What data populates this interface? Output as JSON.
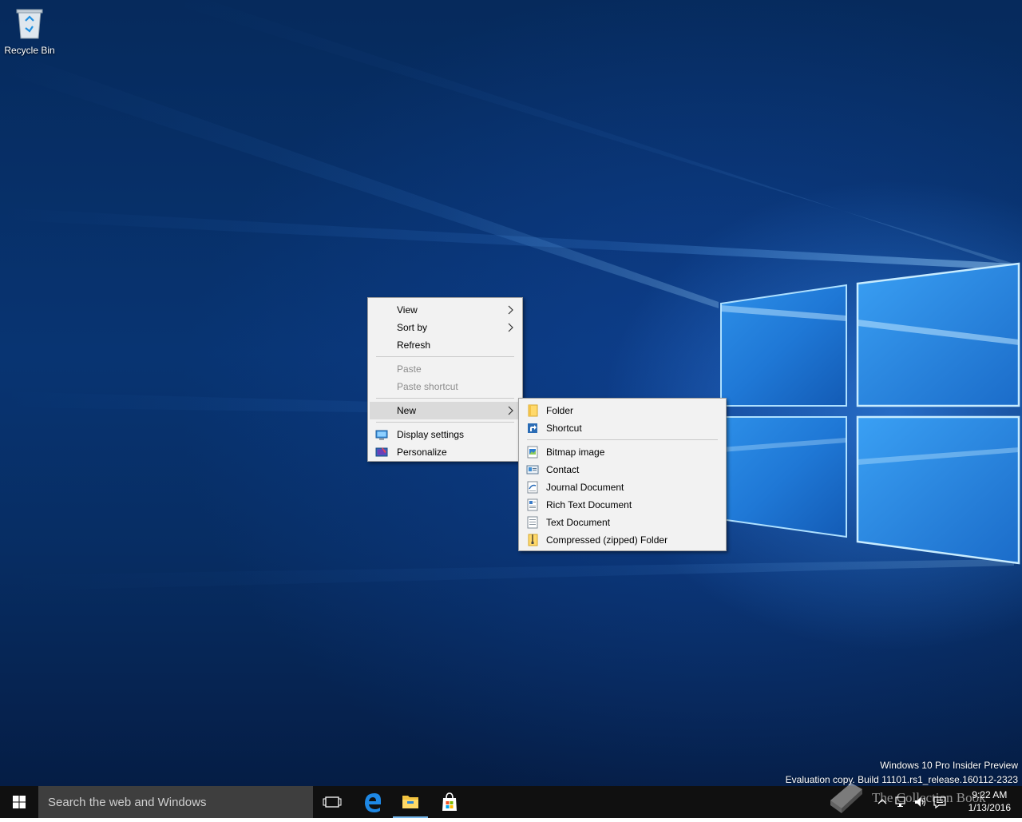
{
  "desktop": {
    "icons": [
      {
        "label": "Recycle Bin",
        "icon": "recycle-bin-icon"
      }
    ]
  },
  "context_menu": {
    "items": [
      {
        "label": "View",
        "has_submenu": true,
        "enabled": true
      },
      {
        "label": "Sort by",
        "has_submenu": true,
        "enabled": true
      },
      {
        "label": "Refresh",
        "has_submenu": false,
        "enabled": true
      },
      {
        "label": "Paste",
        "has_submenu": false,
        "enabled": false
      },
      {
        "label": "Paste shortcut",
        "has_submenu": false,
        "enabled": false
      },
      {
        "label": "New",
        "has_submenu": true,
        "enabled": true,
        "highlighted": true
      },
      {
        "label": "Display settings",
        "icon": "display-icon",
        "enabled": true
      },
      {
        "label": "Personalize",
        "icon": "personalize-icon",
        "enabled": true
      }
    ]
  },
  "new_submenu": {
    "items": [
      {
        "label": "Folder",
        "icon": "folder-icon"
      },
      {
        "label": "Shortcut",
        "icon": "shortcut-icon"
      },
      {
        "label": "Bitmap image",
        "icon": "bitmap-icon"
      },
      {
        "label": "Contact",
        "icon": "contact-icon"
      },
      {
        "label": "Journal Document",
        "icon": "journal-icon"
      },
      {
        "label": "Rich Text Document",
        "icon": "rich-text-icon"
      },
      {
        "label": "Text Document",
        "icon": "text-document-icon"
      },
      {
        "label": "Compressed (zipped) Folder",
        "icon": "zip-folder-icon"
      }
    ]
  },
  "watermark": {
    "line1": "Windows 10 Pro Insider Preview",
    "line2": "Evaluation copy. Build 11101.rs1_release.160112-2323"
  },
  "taskbar": {
    "search_placeholder": "Search the web and Windows",
    "pinned": [
      {
        "name": "task-view",
        "icon": "task-view-icon"
      },
      {
        "name": "edge",
        "icon": "edge-icon"
      },
      {
        "name": "file-explorer",
        "icon": "file-explorer-icon"
      },
      {
        "name": "store",
        "icon": "store-icon"
      }
    ],
    "clock": {
      "time": "9:22 AM",
      "date": "1/13/2016"
    }
  },
  "branding": {
    "text": "The Collection Book"
  },
  "colors": {
    "menu_bg": "#f2f2f2",
    "menu_highlight": "#dadada",
    "taskbar": "#101010",
    "search_bg": "#3e3e3e"
  }
}
